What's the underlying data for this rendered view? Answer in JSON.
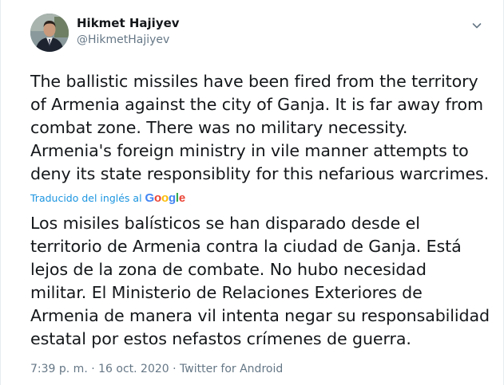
{
  "author": {
    "display_name": "Hikmet Hajiyev",
    "handle": "@HikmetHajiyev"
  },
  "tweet": {
    "text": "The ballistic missiles have been fired from the territory\nof Armenia against the city of Ganja. It is far away from\ncombat zone. There was no military necessity.\nArmenia's foreign ministry in vile manner attempts to\ndeny its state responsiblity for this nefarious warcrimes.",
    "translated_by_label": "Traducido del inglés al",
    "translation_provider": "Google",
    "translated_text": "Los misiles balísticos se han disparado desde el\nterritorio de Armenia contra la ciudad de Ganja. Está\nlejos de la zona de combate. No hubo necesidad\nmilitar. El Ministerio de Relaciones Exteriores de\nArmenia de manera vil intenta negar su responsabilidad\nestatal por estos nefastos crímenes de guerra."
  },
  "meta": {
    "time": "7:39 p. m.",
    "separator": "·",
    "date": "16 oct. 2020",
    "source": "Twitter for Android"
  },
  "icons": {
    "caret": "chevron-down-icon",
    "avatar": "avatar"
  },
  "colors": {
    "text": "#14171a",
    "secondary": "#657786",
    "link": "#1b95e0"
  }
}
